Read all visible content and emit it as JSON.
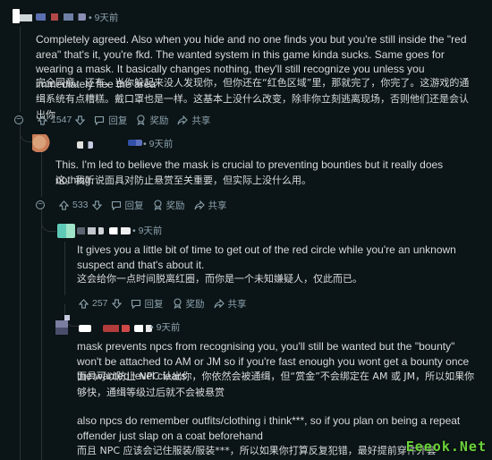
{
  "comments": [
    {
      "time": "9天前",
      "en": "Completely agreed. Also when you hide and no one finds you but you're still inside the \"red area\" that's it, you're fkd. The wanted system in this game kinda sucks. Same goes for wearing a mask. It basically changes nothing, they'll still recognize you unless you immediately flee the area",
      "zh": "完全同意。还有，当你躲起来没人发现你，但你还在“红色区域”里，那就完了，你完了。这游戏的通缉系统有点糟糕。戴口罩也是一样。这基本上没什么改变，除非你立刻逃离现场，否则他们还是会认出你",
      "votes": "1547",
      "reply": "回复",
      "award": "奖励",
      "share": "共享"
    },
    {
      "time": "9天前",
      "en": "This. I'm led to believe the mask is crucial to preventing bounties but it really does nothing.",
      "zh": "这。我听说面具对防止悬赏至关重要，但实际上没什么用。",
      "votes": "533",
      "reply": "回复",
      "award": "奖励",
      "share": "共享"
    },
    {
      "time": "9天前",
      "en": "It gives you a little bit of time to get out of the red circle while you're an unknown suspect and that's about it.",
      "zh": "这会给你一点时间脱离红圈，而你是一个未知嫌疑人，仅此而已。",
      "votes": "257",
      "reply": "回复",
      "award": "奖励",
      "share": "共享"
    },
    {
      "time": "9天前",
      "en1": "mask prevents npcs from recognising you, you'll still be wanted but the \"bounty\" won't be attached to AM or JM so if you're fast enough you wont get a bounty once the wanted level clears",
      "zh1": "面具可以防止 NPC 认出你，你依然会被通缉，但“赏金”不会绑定在 AM 或 JM，所以如果你够快，通缉等级过后就不会被悬赏",
      "en2": "also npcs do remember outfits/clothing i think***, so if you plan on being a repeat offender just slap on a coat beforehand",
      "zh2": "而且 NPC 应该会记住服装/服装***，所以如果你打算反复犯错，最好提前穿件外套"
    }
  ],
  "watermark": "Eeeok.Net"
}
